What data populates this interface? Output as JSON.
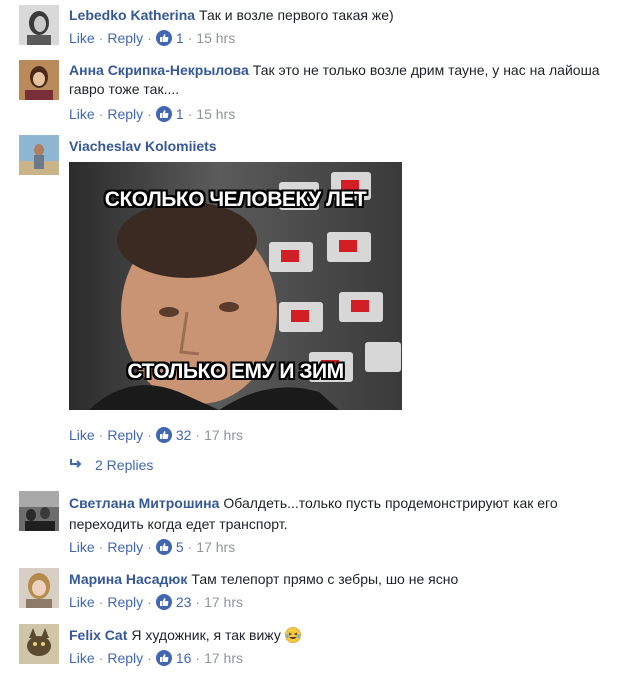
{
  "actions": {
    "like": "Like",
    "reply": "Reply",
    "separator": "·"
  },
  "comments": [
    {
      "author": "Lebedko Katherina",
      "text": "Так и возле первого такая же)",
      "likes": "1",
      "time": "15 hrs"
    },
    {
      "author": "Анна Скрипка-Некрылова",
      "text": "Так это не только возле дрим тауне, у нас на лайоша гавро тоже так....",
      "likes": "1",
      "time": "15 hrs"
    },
    {
      "author": "Viacheslav Kolomiiets",
      "text": "",
      "meme": {
        "top_caption": "СКОЛЬКО ЧЕЛОВЕКУ ЛЕТ",
        "bottom_caption": "СТОЛЬКО ЕМУ И ЗИМ"
      },
      "likes": "32",
      "time": "17 hrs",
      "replies_label": "2 Replies"
    },
    {
      "author": "Светлана Митрошина",
      "text": "Обалдеть...только пусть продемонстрируют как его переходить когда едет транспорт.",
      "likes": "5",
      "time": "17 hrs"
    },
    {
      "author": "Марина Насадюк",
      "text": "Там телепорт прямо с зебры, шо не ясно",
      "likes": "23",
      "time": "17 hrs"
    },
    {
      "author": "Felix Cat",
      "text": "Я художник, я так вижу",
      "emoji": "laughing-tears-emoji",
      "likes": "16",
      "time": "17 hrs"
    }
  ],
  "colors": {
    "author": "#365899",
    "link": "#4267b2",
    "meta": "#90949c",
    "text": "#1d2129"
  }
}
